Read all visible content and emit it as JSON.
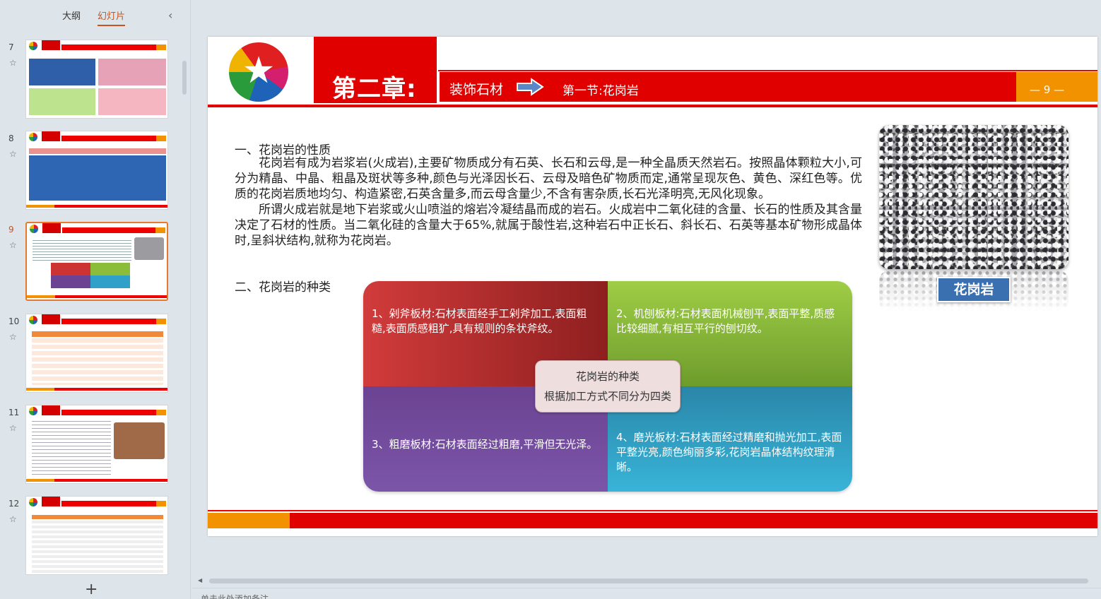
{
  "panel": {
    "tab_outline": "大纲",
    "tab_slides": "幻灯片",
    "collapse_icon": "‹",
    "thumbnails": [
      {
        "num": "7",
        "active": false
      },
      {
        "num": "8",
        "active": false
      },
      {
        "num": "9",
        "active": true
      },
      {
        "num": "10",
        "active": false
      },
      {
        "num": "11",
        "active": false
      },
      {
        "num": "12",
        "active": false
      }
    ],
    "add_icon": "+"
  },
  "slide": {
    "chapter": "第二章:",
    "title": "装饰石材",
    "section": "第一节:花岗岩",
    "page": "— 9 —",
    "heading1": "一、花岗岩的性质",
    "para1": "花岗岩有成为岩浆岩(火成岩),主要矿物质成分有石英、长石和云母,是一种全晶质天然岩石。按照晶体颗粒大小,可分为精晶、中晶、粗晶及斑状等多种,颜色与光泽因长石、云母及暗色矿物质而定,通常呈现灰色、黄色、深红色等。优质的花岗岩质地均匀、构造紧密,石英含量多,而云母含量少,不含有害杂质,长石光泽明亮,无风化现象。",
    "para2": "所谓火成岩就是地下岩浆或火山喷溢的熔岩冷凝结晶而成的岩石。火成岩中二氧化硅的含量、长石的性质及其含量决定了石材的性质。当二氧化硅的含量大于65%,就属于酸性岩,这种岩石中正长石、斜长石、石英等基本矿物形成晶体时,呈斜状结构,就称为花岗岩。",
    "heading2": "二、花岗岩的种类",
    "image_label": "花岗岩",
    "q1": "1、剁斧板材:石材表面经手工剁斧加工,表面粗糙,表面质感粗犷,具有规则的条状斧纹。",
    "q2": "2、机刨板材:石材表面机械刨平,表面平整,质感比较细腻,有相互平行的刨切纹。",
    "q3": "3、粗磨板材:石材表面经过粗磨,平滑但无光泽。",
    "q4": "4、磨光板材:石材表面经过精磨和抛光加工,表面平整光亮,颜色绚丽多彩,花岗岩晶体结构纹理清晰。",
    "center_line1": "花岗岩的种类",
    "center_line2": "根据加工方式不同分为四类"
  },
  "notes_placeholder": "单击此处添加备注",
  "colors": {
    "red": "#e00000",
    "orange": "#f39200",
    "accent": "#c9541d"
  }
}
